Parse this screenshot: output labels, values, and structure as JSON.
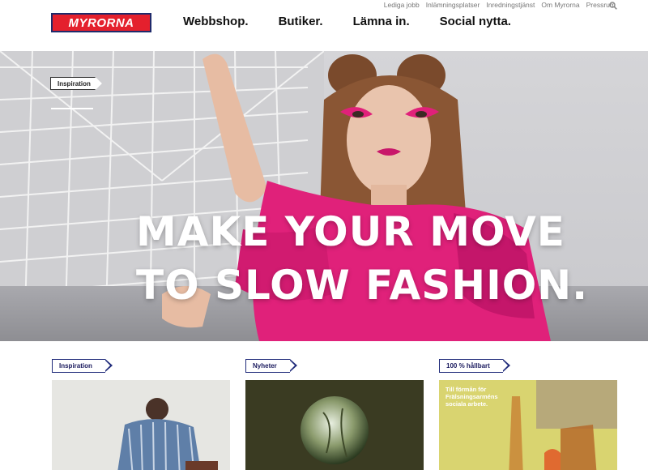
{
  "brand": {
    "logo_text": "MYRORNA",
    "primary_red": "#e4202d",
    "navy": "#1f2a6b",
    "accent_pink": "#e0217a"
  },
  "top_links": [
    "Lediga jobb",
    "Inlämningsplatser",
    "Inredningstjänst",
    "Om Myrorna",
    "Pressrum"
  ],
  "main_nav": [
    "Webbshop.",
    "Butiker.",
    "Lämna in.",
    "Social nytta."
  ],
  "hero": {
    "tag": "Inspiration",
    "title_line1": "MAKE YOUR MOVE",
    "title_line2": "TO SLOW FASHION."
  },
  "cards": [
    {
      "tag": "Inspiration",
      "image_icon": "fashion-model-photo"
    },
    {
      "tag": "Nyheter",
      "image_icon": "glass-sphere-photo"
    },
    {
      "tag": "100 % hållbart",
      "image_icon": "glass-vases-photo",
      "image_text": "Till förmån för Frälsningsarméns sociala arbete."
    }
  ]
}
